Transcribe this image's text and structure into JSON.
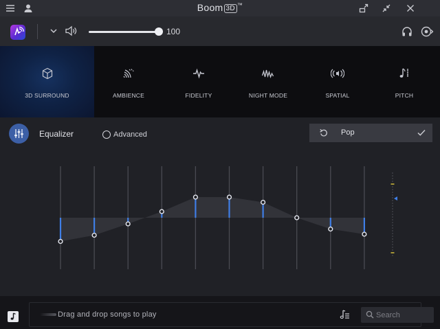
{
  "window": {
    "title": "Boom",
    "title_badge": "3D",
    "title_mark": "™"
  },
  "volume": {
    "level": 100,
    "level_text": "100"
  },
  "effects": [
    {
      "label": "3D SURROUND",
      "icon": "cube-icon",
      "active": true
    },
    {
      "label": "AMBIENCE",
      "icon": "ambience-waves-icon",
      "active": false
    },
    {
      "label": "FIDELITY",
      "icon": "pulse-icon",
      "active": false
    },
    {
      "label": "NIGHT MODE",
      "icon": "night-wave-icon",
      "active": false
    },
    {
      "label": "SPATIAL",
      "icon": "spatial-speaker-icon",
      "active": false
    },
    {
      "label": "PITCH",
      "icon": "music-note-icon",
      "active": false
    }
  ],
  "equalizer": {
    "title": "Equalizer",
    "advanced_label": "Advanced",
    "advanced_checked": false,
    "preset_name": "Pop",
    "band_levels": [
      0.27,
      0.33,
      0.44,
      0.56,
      0.7,
      0.7,
      0.65,
      0.5,
      0.39,
      0.34
    ],
    "accent_color": "#3f7ee6",
    "gain_indicator_color": "#3f7ee6",
    "marker_color": "#c8b43a"
  },
  "bottom": {
    "drop_text": "Drag and drop songs to play",
    "search_placeholder": "Search"
  },
  "colors": {
    "background": "#202126",
    "effects_bar": "#0d0d10",
    "active_effect": "#16315f"
  }
}
